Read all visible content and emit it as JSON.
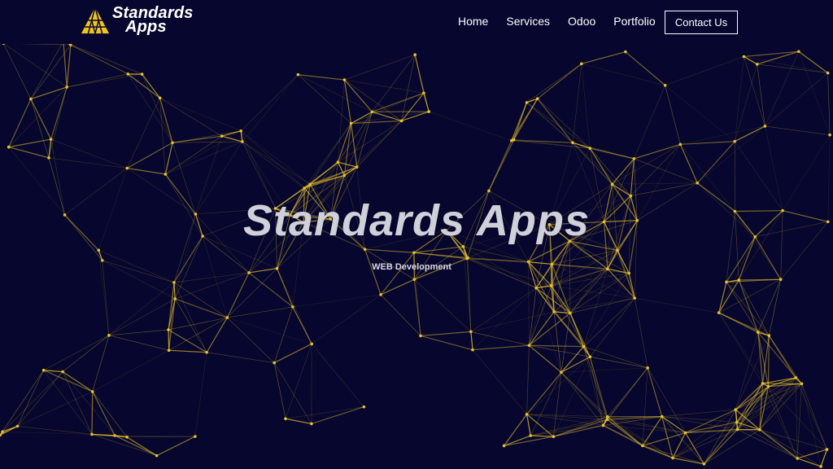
{
  "brand": {
    "line1": "Standards",
    "line2": "Apps",
    "accent": "#f0c419"
  },
  "nav": {
    "items": [
      {
        "label": "Home"
      },
      {
        "label": "Services"
      },
      {
        "label": "Odoo"
      },
      {
        "label": "Portfolio"
      }
    ],
    "cta_label": "Contact Us"
  },
  "hero": {
    "title": "Standards Apps",
    "subtitle": "WEB Development"
  },
  "colors": {
    "background": "#06062e",
    "network": "#e8c22a"
  },
  "icons": {
    "logo": "pyramid-logo-icon"
  }
}
